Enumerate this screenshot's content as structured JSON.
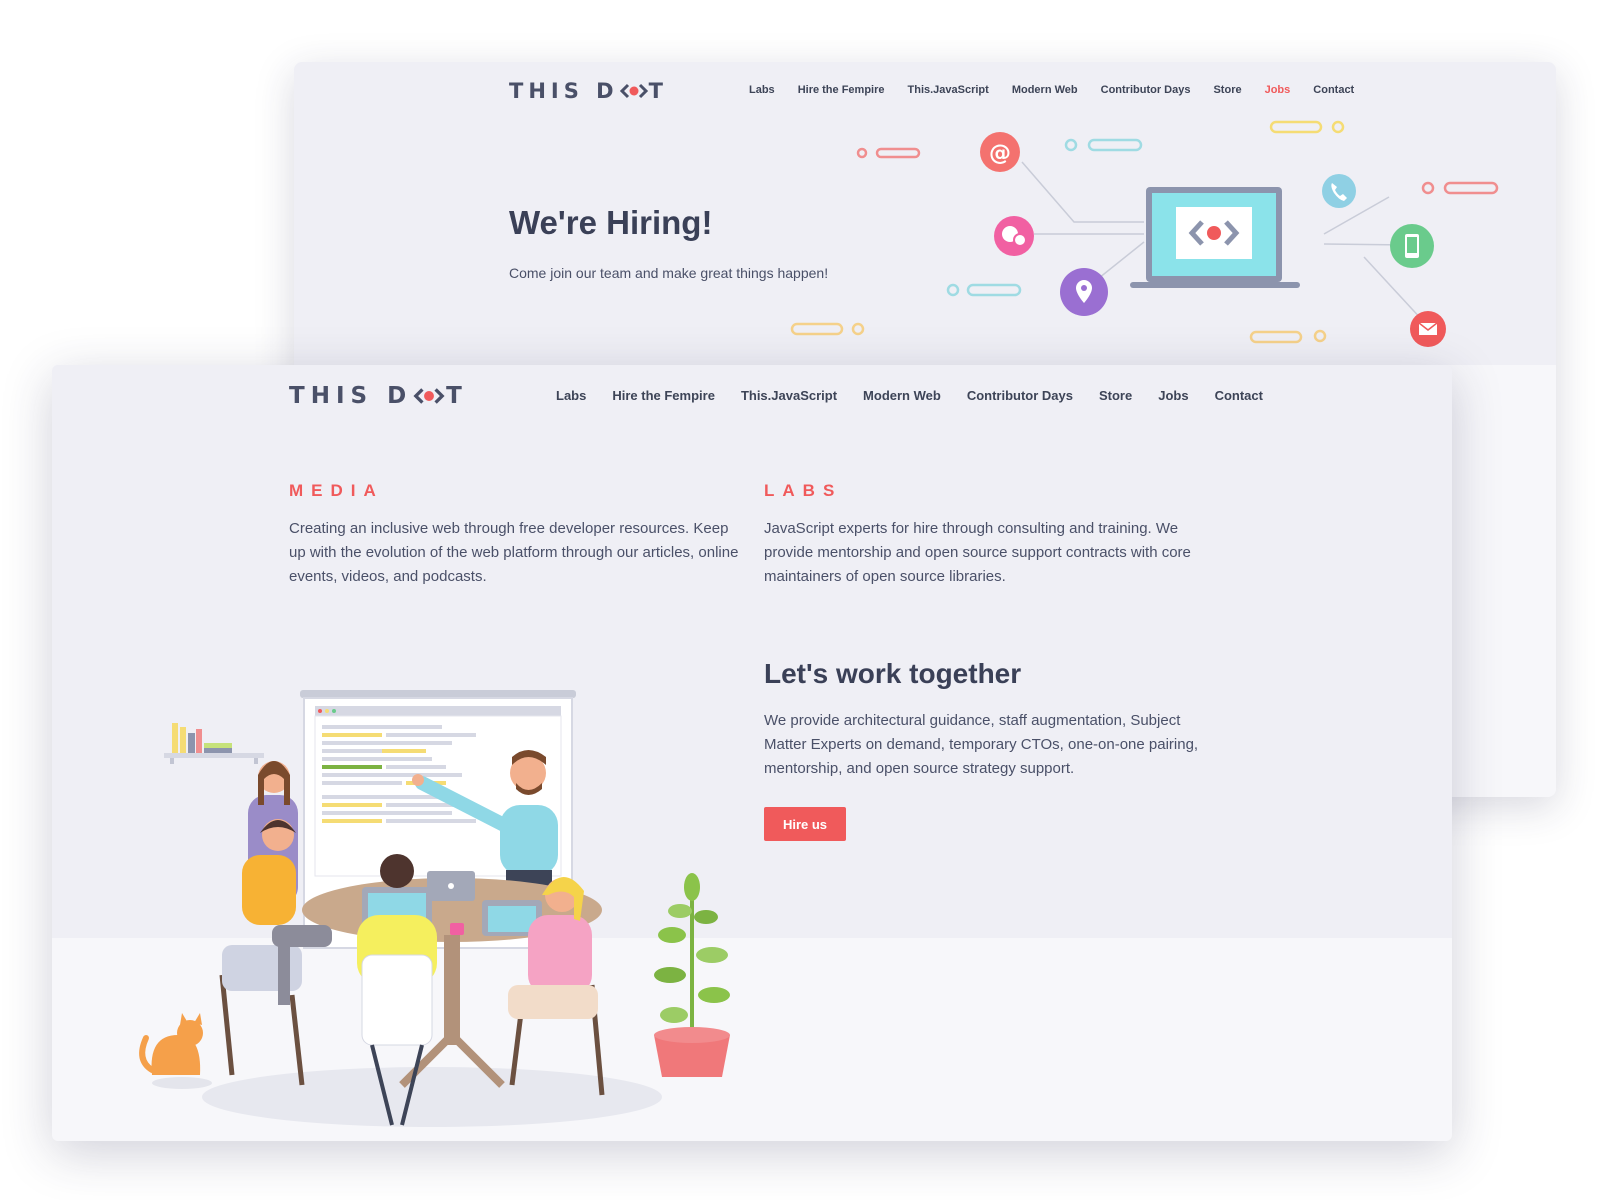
{
  "colors": {
    "accent": "#f05a5b",
    "text_dark": "#3a4057",
    "background": "#efeff5"
  },
  "back_page": {
    "logo": {
      "left": "THIS D",
      "right": "T",
      "mark": "dot-logo-icon"
    },
    "nav": [
      {
        "label": "Labs",
        "active": false
      },
      {
        "label": "Hire the Fempire",
        "active": false
      },
      {
        "label": "This.JavaScript",
        "active": false
      },
      {
        "label": "Modern Web",
        "active": false
      },
      {
        "label": "Contributor Days",
        "active": false
      },
      {
        "label": "Store",
        "active": false
      },
      {
        "label": "Jobs",
        "active": true
      },
      {
        "label": "Contact",
        "active": false
      }
    ],
    "hero": {
      "title": "We're Hiring!",
      "subtitle": "Come join our team and make great things happen!",
      "illustration_icons": [
        "at-icon",
        "chat-icon",
        "location-icon",
        "laptop-icon",
        "phone-icon",
        "mobile-icon",
        "mail-icon"
      ]
    }
  },
  "front_page": {
    "logo": {
      "left": "THIS D",
      "right": "T",
      "mark": "dot-logo-icon"
    },
    "nav": [
      {
        "label": "Labs"
      },
      {
        "label": "Hire the Fempire"
      },
      {
        "label": "This.JavaScript"
      },
      {
        "label": "Modern Web"
      },
      {
        "label": "Contributor Days"
      },
      {
        "label": "Store"
      },
      {
        "label": "Jobs"
      },
      {
        "label": "Contact"
      }
    ],
    "media": {
      "label": "MEDIA",
      "body": "Creating an inclusive web through free developer resources. Keep up with the evolution of the web platform through our articles, online events, videos, and podcasts."
    },
    "labs": {
      "label": "LABS",
      "body": "JavaScript experts for hire through consulting and training. We provide mentorship and open source support contracts with core maintainers of open source libraries."
    },
    "work": {
      "title": "Let's work together",
      "body": "We provide architectural guidance, staff augmentation, Subject Matter Experts on demand, temporary CTOs, one-on-one pairing, mentorship, and open source strategy support.",
      "button_label": "Hire us"
    },
    "illustration": "team-meeting-illustration"
  }
}
